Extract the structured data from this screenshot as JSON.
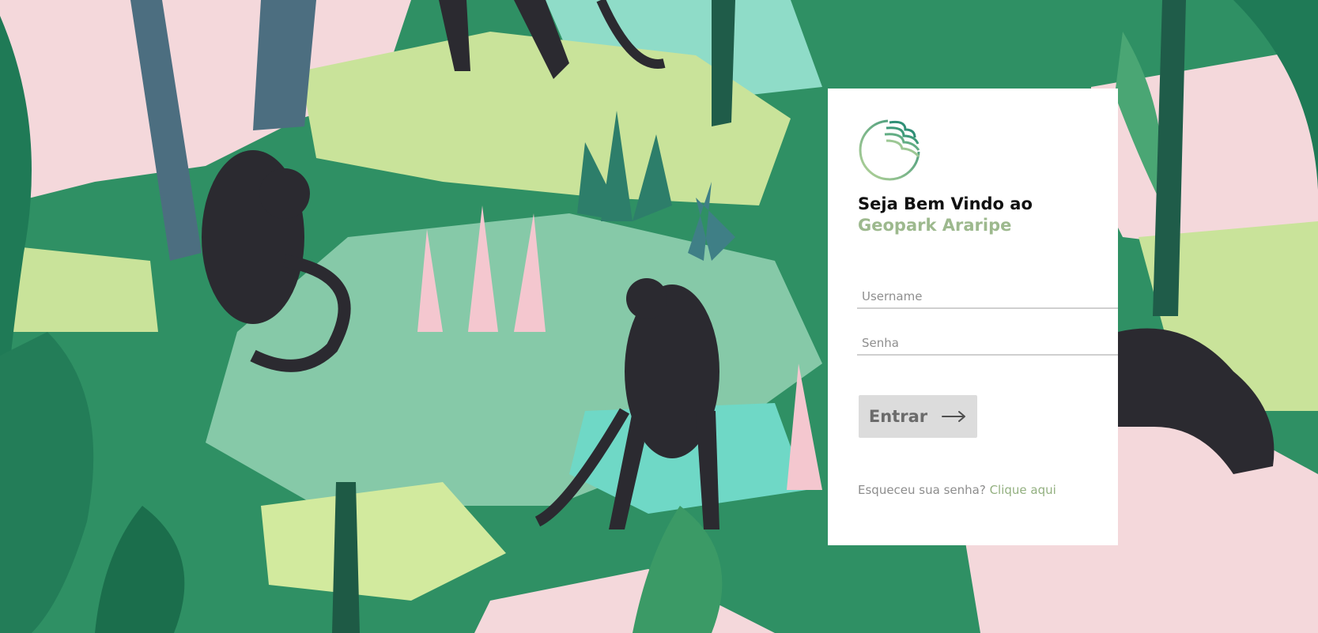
{
  "login": {
    "welcome_line1": "Seja Bem Vindo ao",
    "welcome_line2": "Geopark Araripe",
    "username_placeholder": "Username",
    "password_placeholder": "Senha",
    "submit_label": "Entrar",
    "forgot_text": "Esqueceu sua senha?",
    "forgot_link": "Clique aqui"
  },
  "icons": {
    "logo": "geopark-logo-icon",
    "submit_arrow": "arrow-right-icon"
  },
  "colors": {
    "accent": "#9db98e",
    "link": "#93b080",
    "button_bg": "#dcdcdc",
    "button_text": "#6b6b6b",
    "card_bg": "#ffffff"
  }
}
